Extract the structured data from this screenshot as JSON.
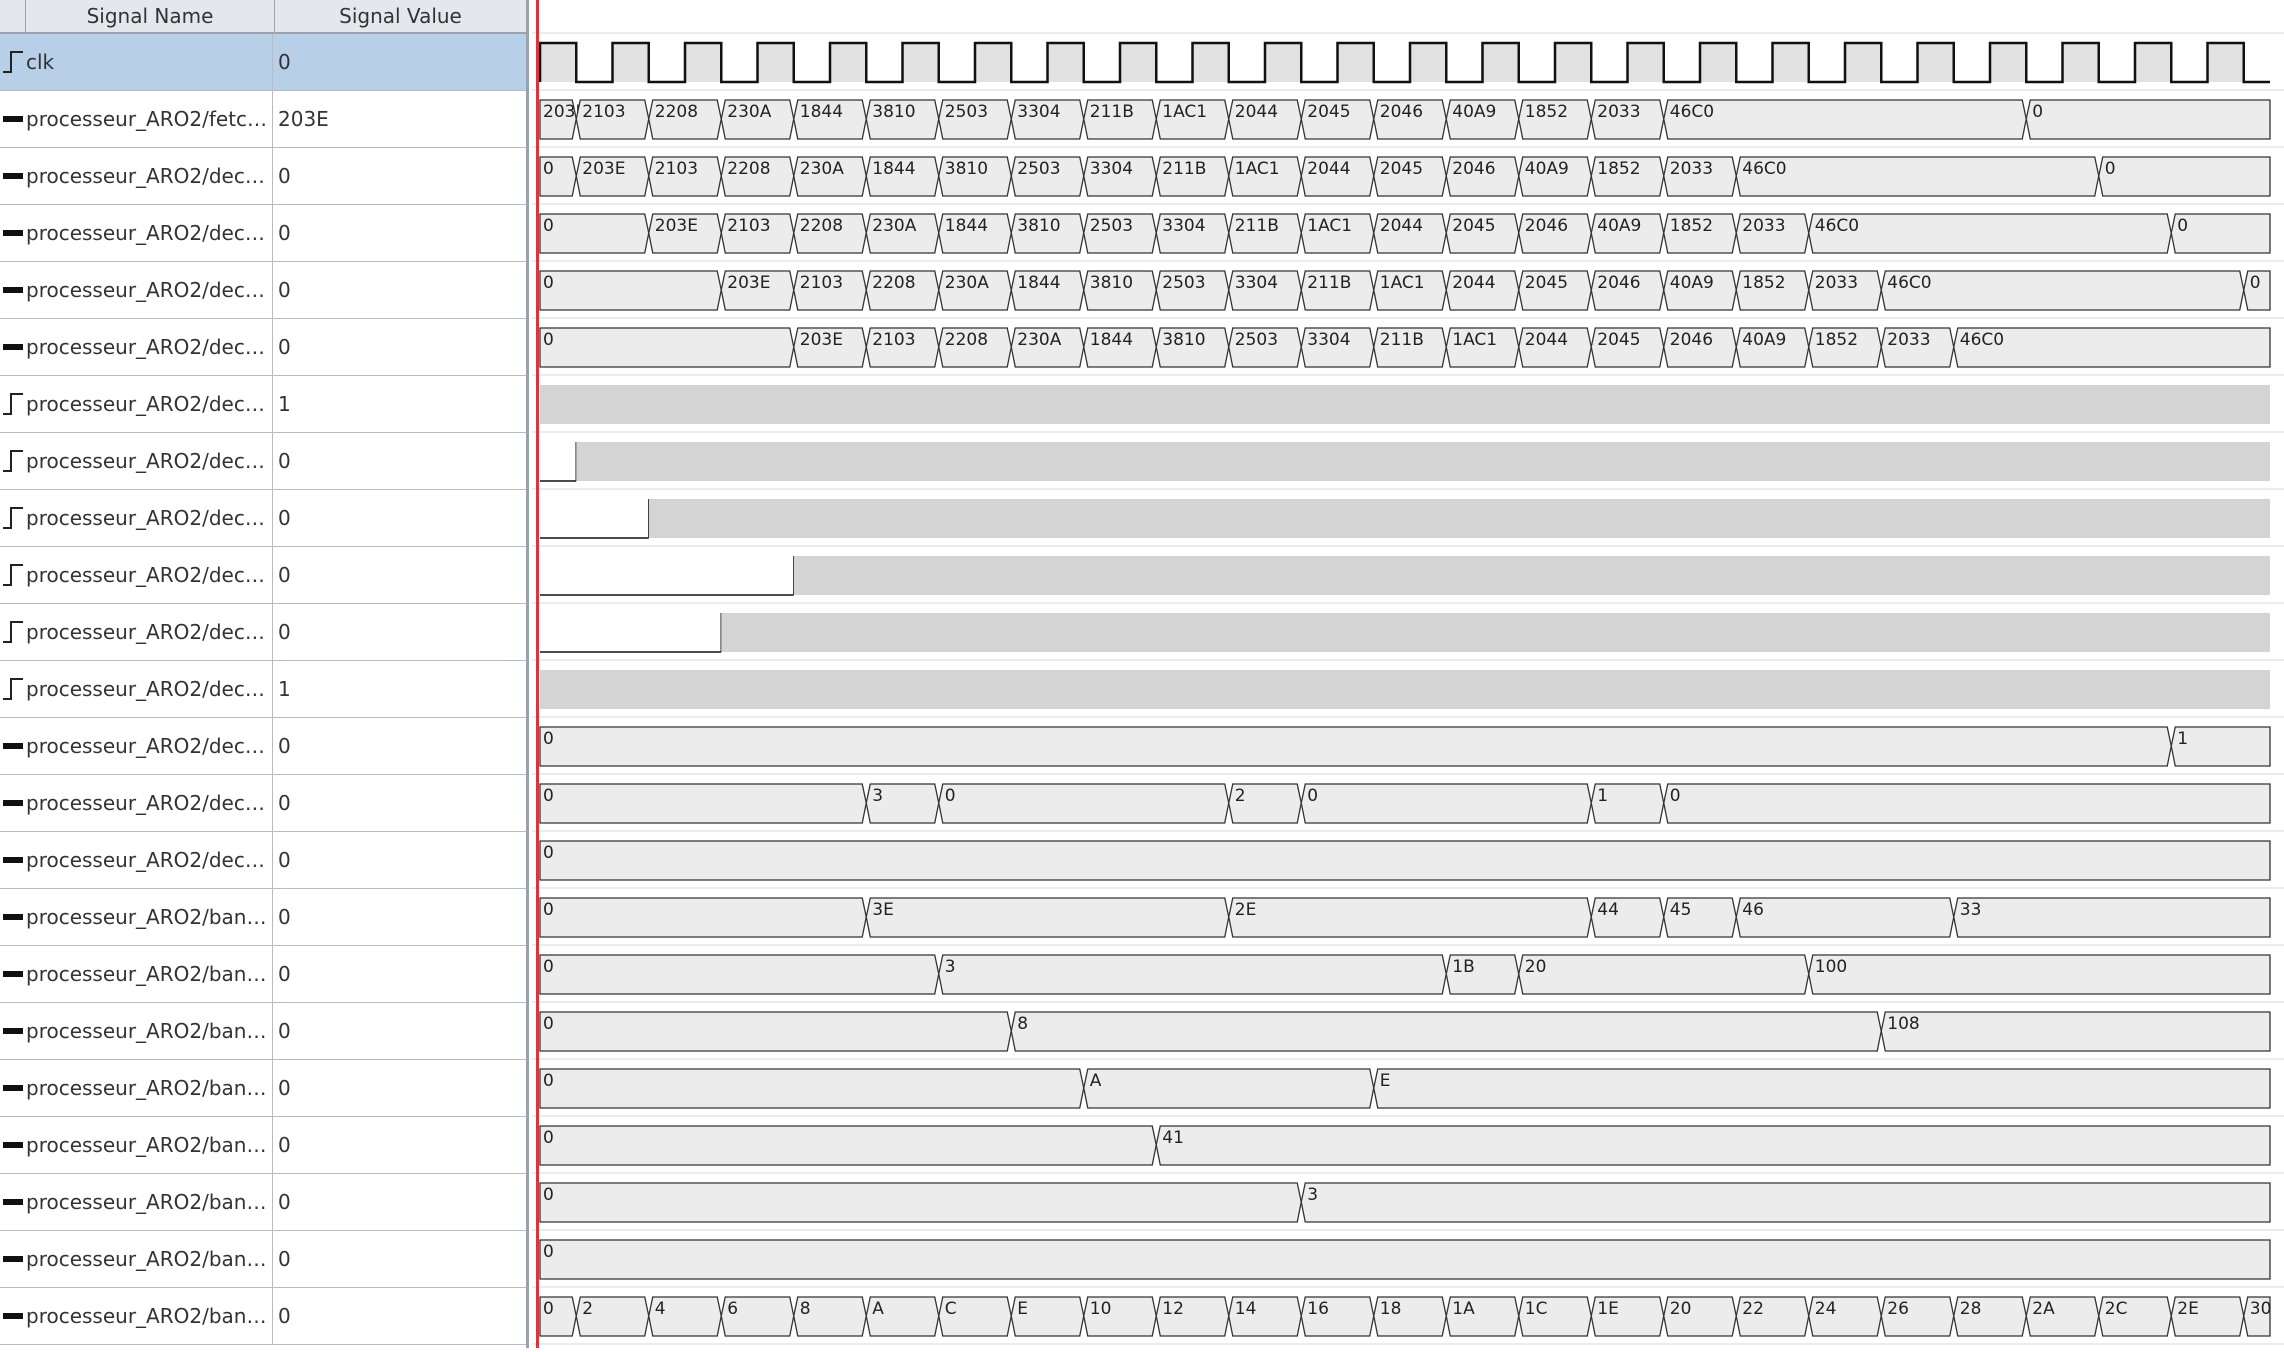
{
  "header": {
    "signal_name": "Signal Name",
    "signal_value": "Signal Value"
  },
  "signals": [
    {
      "name": "clk",
      "value": "0",
      "kind": "bit",
      "selected": true
    },
    {
      "name": "processeur_ARO2/fetch...",
      "value": "203E",
      "kind": "bus"
    },
    {
      "name": "processeur_ARO2/deco...",
      "value": "0",
      "kind": "bus"
    },
    {
      "name": "processeur_ARO2/deco...",
      "value": "0",
      "kind": "bus"
    },
    {
      "name": "processeur_ARO2/deco...",
      "value": "0",
      "kind": "bus"
    },
    {
      "name": "processeur_ARO2/deco...",
      "value": "0",
      "kind": "bus"
    },
    {
      "name": "processeur_ARO2/deco...",
      "value": "1",
      "kind": "bit"
    },
    {
      "name": "processeur_ARO2/deco...",
      "value": "0",
      "kind": "bit"
    },
    {
      "name": "processeur_ARO2/deco...",
      "value": "0",
      "kind": "bit"
    },
    {
      "name": "processeur_ARO2/deco...",
      "value": "0",
      "kind": "bit"
    },
    {
      "name": "processeur_ARO2/deco...",
      "value": "0",
      "kind": "bit"
    },
    {
      "name": "processeur_ARO2/deco...",
      "value": "1",
      "kind": "bit"
    },
    {
      "name": "processeur_ARO2/deco...",
      "value": "0",
      "kind": "bus"
    },
    {
      "name": "processeur_ARO2/deco...",
      "value": "0",
      "kind": "bus"
    },
    {
      "name": "processeur_ARO2/deco...",
      "value": "0",
      "kind": "bus"
    },
    {
      "name": "processeur_ARO2/bank...",
      "value": "0",
      "kind": "bus"
    },
    {
      "name": "processeur_ARO2/bank...",
      "value": "0",
      "kind": "bus"
    },
    {
      "name": "processeur_ARO2/bank...",
      "value": "0",
      "kind": "bus"
    },
    {
      "name": "processeur_ARO2/bank...",
      "value": "0",
      "kind": "bus"
    },
    {
      "name": "processeur_ARO2/bank...",
      "value": "0",
      "kind": "bus"
    },
    {
      "name": "processeur_ARO2/bank...",
      "value": "0",
      "kind": "bus"
    },
    {
      "name": "processeur_ARO2/bank...",
      "value": "0",
      "kind": "bus"
    },
    {
      "name": "processeur_ARO2/bank...",
      "value": "0",
      "kind": "bus"
    }
  ],
  "waves": [
    {
      "type": "clock",
      "period": 2,
      "start_high": 1,
      "cycles": 48
    },
    {
      "type": "bus",
      "segments": [
        [
          0,
          1,
          "203E"
        ],
        [
          1,
          3,
          "2103"
        ],
        [
          3,
          5,
          "2208"
        ],
        [
          5,
          7,
          "230A"
        ],
        [
          7,
          9,
          "1844"
        ],
        [
          9,
          11,
          "3810"
        ],
        [
          11,
          13,
          "2503"
        ],
        [
          13,
          15,
          "3304"
        ],
        [
          15,
          17,
          "211B"
        ],
        [
          17,
          19,
          "1AC1"
        ],
        [
          19,
          21,
          "2044"
        ],
        [
          21,
          23,
          "2045"
        ],
        [
          23,
          25,
          "2046"
        ],
        [
          25,
          27,
          "40A9"
        ],
        [
          27,
          29,
          "1852"
        ],
        [
          29,
          31,
          "2033"
        ],
        [
          31,
          41,
          "46C0"
        ],
        [
          41,
          48,
          "0"
        ]
      ]
    },
    {
      "type": "bus",
      "segments": [
        [
          0,
          1,
          "0"
        ],
        [
          1,
          3,
          "203E"
        ],
        [
          3,
          5,
          "2103"
        ],
        [
          5,
          7,
          "2208"
        ],
        [
          7,
          9,
          "230A"
        ],
        [
          9,
          11,
          "1844"
        ],
        [
          11,
          13,
          "3810"
        ],
        [
          13,
          15,
          "2503"
        ],
        [
          15,
          17,
          "3304"
        ],
        [
          17,
          19,
          "211B"
        ],
        [
          19,
          21,
          "1AC1"
        ],
        [
          21,
          23,
          "2044"
        ],
        [
          23,
          25,
          "2045"
        ],
        [
          25,
          27,
          "2046"
        ],
        [
          27,
          29,
          "40A9"
        ],
        [
          29,
          31,
          "1852"
        ],
        [
          31,
          33,
          "2033"
        ],
        [
          33,
          43,
          "46C0"
        ],
        [
          43,
          48,
          "0"
        ]
      ]
    },
    {
      "type": "bus",
      "segments": [
        [
          0,
          3,
          "0"
        ],
        [
          3,
          5,
          "203E"
        ],
        [
          5,
          7,
          "2103"
        ],
        [
          7,
          9,
          "2208"
        ],
        [
          9,
          11,
          "230A"
        ],
        [
          11,
          13,
          "1844"
        ],
        [
          13,
          15,
          "3810"
        ],
        [
          15,
          17,
          "2503"
        ],
        [
          17,
          19,
          "3304"
        ],
        [
          19,
          21,
          "211B"
        ],
        [
          21,
          23,
          "1AC1"
        ],
        [
          23,
          25,
          "2044"
        ],
        [
          25,
          27,
          "2045"
        ],
        [
          27,
          29,
          "2046"
        ],
        [
          29,
          31,
          "40A9"
        ],
        [
          31,
          33,
          "1852"
        ],
        [
          33,
          35,
          "2033"
        ],
        [
          35,
          45,
          "46C0"
        ],
        [
          45,
          48,
          "0"
        ]
      ]
    },
    {
      "type": "bus",
      "segments": [
        [
          0,
          5,
          "0"
        ],
        [
          5,
          7,
          "203E"
        ],
        [
          7,
          9,
          "2103"
        ],
        [
          9,
          11,
          "2208"
        ],
        [
          11,
          13,
          "230A"
        ],
        [
          13,
          15,
          "1844"
        ],
        [
          15,
          17,
          "3810"
        ],
        [
          17,
          19,
          "2503"
        ],
        [
          19,
          21,
          "3304"
        ],
        [
          21,
          23,
          "211B"
        ],
        [
          23,
          25,
          "1AC1"
        ],
        [
          25,
          27,
          "2044"
        ],
        [
          27,
          29,
          "2045"
        ],
        [
          29,
          31,
          "2046"
        ],
        [
          31,
          33,
          "40A9"
        ],
        [
          33,
          35,
          "1852"
        ],
        [
          35,
          37,
          "2033"
        ],
        [
          37,
          47,
          "46C0"
        ],
        [
          47,
          48,
          "0"
        ]
      ]
    },
    {
      "type": "bus",
      "segments": [
        [
          0,
          7,
          "0"
        ],
        [
          7,
          9,
          "203E"
        ],
        [
          9,
          11,
          "2103"
        ],
        [
          11,
          13,
          "2208"
        ],
        [
          13,
          15,
          "230A"
        ],
        [
          15,
          17,
          "1844"
        ],
        [
          17,
          19,
          "3810"
        ],
        [
          19,
          21,
          "2503"
        ],
        [
          21,
          23,
          "3304"
        ],
        [
          23,
          25,
          "211B"
        ],
        [
          25,
          27,
          "1AC1"
        ],
        [
          27,
          29,
          "2044"
        ],
        [
          29,
          31,
          "2045"
        ],
        [
          31,
          33,
          "2046"
        ],
        [
          33,
          35,
          "40A9"
        ],
        [
          35,
          37,
          "1852"
        ],
        [
          37,
          39,
          "2033"
        ],
        [
          39,
          48,
          "46C0"
        ]
      ]
    },
    {
      "type": "bit",
      "initial": 1,
      "edges": []
    },
    {
      "type": "bit",
      "initial": 0,
      "edges": [
        1
      ]
    },
    {
      "type": "bit",
      "initial": 0,
      "edges": [
        3
      ]
    },
    {
      "type": "bit",
      "initial": 0,
      "edges": [
        7
      ]
    },
    {
      "type": "bit",
      "initial": 0,
      "edges": [
        5
      ]
    },
    {
      "type": "bit",
      "initial": 1,
      "edges": []
    },
    {
      "type": "bus",
      "segments": [
        [
          0,
          45,
          "0"
        ],
        [
          45,
          48,
          "1"
        ]
      ]
    },
    {
      "type": "bus",
      "segments": [
        [
          0,
          9,
          "0"
        ],
        [
          9,
          11,
          "3"
        ],
        [
          11,
          19,
          "0"
        ],
        [
          19,
          21,
          "2"
        ],
        [
          21,
          29,
          "0"
        ],
        [
          29,
          31,
          "1"
        ],
        [
          31,
          48,
          "0"
        ]
      ]
    },
    {
      "type": "bus",
      "segments": [
        [
          0,
          48,
          "0"
        ]
      ]
    },
    {
      "type": "bus",
      "segments": [
        [
          0,
          9,
          "0"
        ],
        [
          9,
          19,
          "3E"
        ],
        [
          19,
          29,
          "2E"
        ],
        [
          29,
          31,
          "44"
        ],
        [
          31,
          33,
          "45"
        ],
        [
          33,
          39,
          "46"
        ],
        [
          39,
          48,
          "33"
        ]
      ]
    },
    {
      "type": "bus",
      "segments": [
        [
          0,
          11,
          "0"
        ],
        [
          11,
          25,
          "3"
        ],
        [
          25,
          27,
          "1B"
        ],
        [
          27,
          35,
          "20"
        ],
        [
          35,
          48,
          "100"
        ]
      ]
    },
    {
      "type": "bus",
      "segments": [
        [
          0,
          13,
          "0"
        ],
        [
          13,
          37,
          "8"
        ],
        [
          37,
          48,
          "108"
        ]
      ]
    },
    {
      "type": "bus",
      "segments": [
        [
          0,
          15,
          "0"
        ],
        [
          15,
          23,
          "A"
        ],
        [
          23,
          48,
          "E"
        ]
      ]
    },
    {
      "type": "bus",
      "segments": [
        [
          0,
          17,
          "0"
        ],
        [
          17,
          48,
          "41"
        ]
      ]
    },
    {
      "type": "bus",
      "segments": [
        [
          0,
          21,
          "0"
        ],
        [
          21,
          48,
          "3"
        ]
      ]
    },
    {
      "type": "bus",
      "segments": [
        [
          0,
          48,
          "0"
        ]
      ]
    },
    {
      "type": "bus",
      "segments": [
        [
          0,
          1,
          "0"
        ],
        [
          1,
          3,
          "2"
        ],
        [
          3,
          5,
          "4"
        ],
        [
          5,
          7,
          "6"
        ],
        [
          7,
          9,
          "8"
        ],
        [
          9,
          11,
          "A"
        ],
        [
          11,
          13,
          "C"
        ],
        [
          13,
          15,
          "E"
        ],
        [
          15,
          17,
          "10"
        ],
        [
          17,
          19,
          "12"
        ],
        [
          19,
          21,
          "14"
        ],
        [
          21,
          23,
          "16"
        ],
        [
          23,
          25,
          "18"
        ],
        [
          25,
          27,
          "1A"
        ],
        [
          27,
          29,
          "1C"
        ],
        [
          29,
          31,
          "1E"
        ],
        [
          31,
          33,
          "20"
        ],
        [
          33,
          35,
          "22"
        ],
        [
          35,
          37,
          "24"
        ],
        [
          37,
          39,
          "26"
        ],
        [
          39,
          41,
          "28"
        ],
        [
          41,
          43,
          "2A"
        ],
        [
          43,
          45,
          "2C"
        ],
        [
          45,
          47,
          "2E"
        ],
        [
          47,
          48,
          "30"
        ]
      ]
    }
  ]
}
